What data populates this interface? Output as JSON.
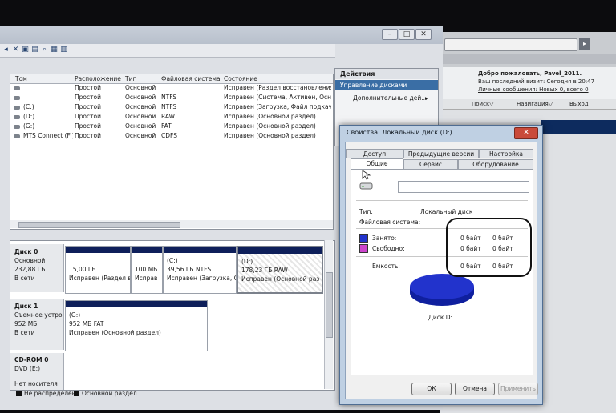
{
  "browser": {
    "go_label": "▸",
    "panel": {
      "line1": "Добро пожаловать, Pavel_2011.",
      "line2": "Ваш последний визит: Сегодня в 20:47",
      "line3": "Личные сообщения: Новых 0, всего 0"
    },
    "menu": {
      "search": "Поиск▽",
      "nav": "Навигация▽",
      "exit": "Выход"
    }
  },
  "disk_mgmt": {
    "toolbar_icons": [
      "back-icon",
      "forward-icon",
      "grid-icon",
      "help-icon",
      "delete-icon",
      "folder-icon",
      "search-icon",
      "properties-icon",
      "list-icon"
    ],
    "columns": [
      "Том",
      "Расположение",
      "Тип",
      "Файловая система",
      "Состояние"
    ],
    "volumes": [
      {
        "name": "",
        "layout": "Простой",
        "type": "Основной",
        "fs": "",
        "status": "Исправен (Раздел восстановления)"
      },
      {
        "name": "",
        "layout": "Простой",
        "type": "Основной",
        "fs": "NTFS",
        "status": "Исправен (Система, Активен, Основной"
      },
      {
        "name": "(C:)",
        "layout": "Простой",
        "type": "Основной",
        "fs": "NTFS",
        "status": "Исправен (Загрузка, Файл подкачк"
      },
      {
        "name": "(D:)",
        "layout": "Простой",
        "type": "Основной",
        "fs": "RAW",
        "status": "Исправен (Основной раздел)"
      },
      {
        "name": "(G:)",
        "layout": "Простой",
        "type": "Основной",
        "fs": "FAT",
        "status": "Исправен (Основной раздел)"
      },
      {
        "name": "MTS Connect (F:)",
        "layout": "Простой",
        "type": "Основной",
        "fs": "CDFS",
        "status": "Исправен (Основной раздел)"
      }
    ],
    "actions": {
      "title": "Действия",
      "selected": "Управление дисками",
      "more": "Дополнительные дей...",
      "more_arrow": "▸"
    },
    "disks": [
      {
        "name": "Диск 0",
        "kind": "Основной",
        "size": "232,88 ГБ",
        "state": "В сети",
        "partitions": [
          {
            "label": "",
            "size": "15,00 ГБ",
            "status": "Исправен (Раздел в"
          },
          {
            "label": "",
            "size": "100 МБ",
            "status": "Исправ"
          },
          {
            "label": "(C:)",
            "size": "39,56 ГБ NTFS",
            "status": "Исправен (Загрузка, С"
          },
          {
            "label": "(D:)",
            "size": "178,23 ГБ RAW",
            "status": "Исправен (Основной раз"
          }
        ]
      },
      {
        "name": "Диск 1",
        "kind": "Съемное устро",
        "size": "952 МБ",
        "state": "В сети",
        "partitions": [
          {
            "label": "(G:)",
            "size": "952 МБ FAT",
            "status": "Исправен (Основной раздел)"
          }
        ]
      },
      {
        "name": "CD-ROM 0",
        "kind": "DVD (E:)",
        "size": "",
        "state": "Нет носителя"
      }
    ],
    "legend": {
      "unallocated": "Не распределен",
      "primary": "Основной раздел"
    }
  },
  "dialog": {
    "title": "Свойства: Локальный диск (D:)",
    "close_label": "✕",
    "tabs_row1": [
      "Доступ",
      "Предыдущие версии",
      "Настройка"
    ],
    "tabs_row2": [
      "Общие",
      "Сервис",
      "Оборудование"
    ],
    "name_value": "",
    "type_label": "Тип:",
    "type_value": "Локальный диск",
    "fs_label": "Файловая система:",
    "used_label": "Занято:",
    "used_bytes": "0 байт",
    "used_size": "0 байт",
    "free_label": "Свободно:",
    "free_bytes": "0 байт",
    "free_size": "0 байт",
    "capacity_label": "Емкость:",
    "capacity_bytes": "0 байт",
    "capacity_size": "0 байт",
    "disk_label": "Диск D:",
    "used_color": "#2233cc",
    "free_color": "#cc44cc",
    "ok": "ОК",
    "cancel": "Отмена",
    "apply": "Применить"
  }
}
